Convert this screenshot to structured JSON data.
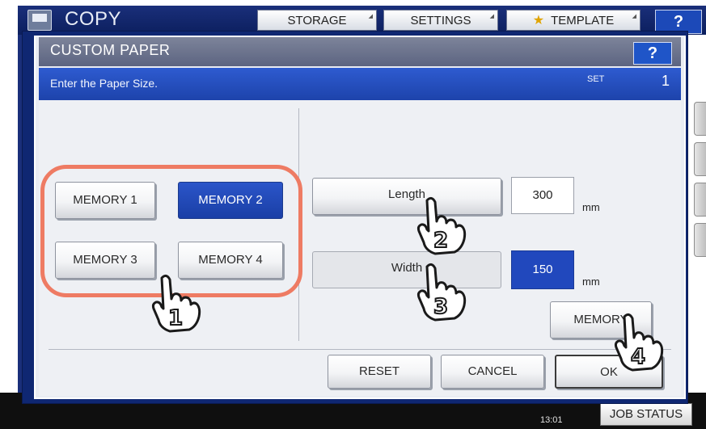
{
  "app": {
    "title": "COPY",
    "tabs": [
      {
        "label": "STORAGE"
      },
      {
        "label": "SETTINGS"
      },
      {
        "label": "TEMPLATE"
      }
    ],
    "help_label": "?"
  },
  "dialog": {
    "title": "CUSTOM PAPER",
    "help_label": "?",
    "instruction": "Enter the Paper Size.",
    "set_label": "SET",
    "set_count": "1"
  },
  "memory": {
    "buttons": [
      {
        "label": "MEMORY 1",
        "selected": false
      },
      {
        "label": "MEMORY 2",
        "selected": true
      },
      {
        "label": "MEMORY 3",
        "selected": false
      },
      {
        "label": "MEMORY 4",
        "selected": false
      }
    ]
  },
  "size": {
    "length": {
      "label": "Length",
      "value": "300",
      "unit": "mm"
    },
    "width": {
      "label": "Width",
      "value": "150",
      "unit": "mm"
    },
    "memory_button": "MEMORY"
  },
  "footer": {
    "reset": "RESET",
    "cancel": "CANCEL",
    "ok": "OK"
  },
  "status": {
    "time": "13:01",
    "job_status": "JOB STATUS"
  },
  "steps": [
    "1",
    "2",
    "3",
    "4"
  ],
  "colors": {
    "accent": "#2148bd",
    "highlight": "#ee7b63",
    "title_bar": "#5c6481"
  }
}
